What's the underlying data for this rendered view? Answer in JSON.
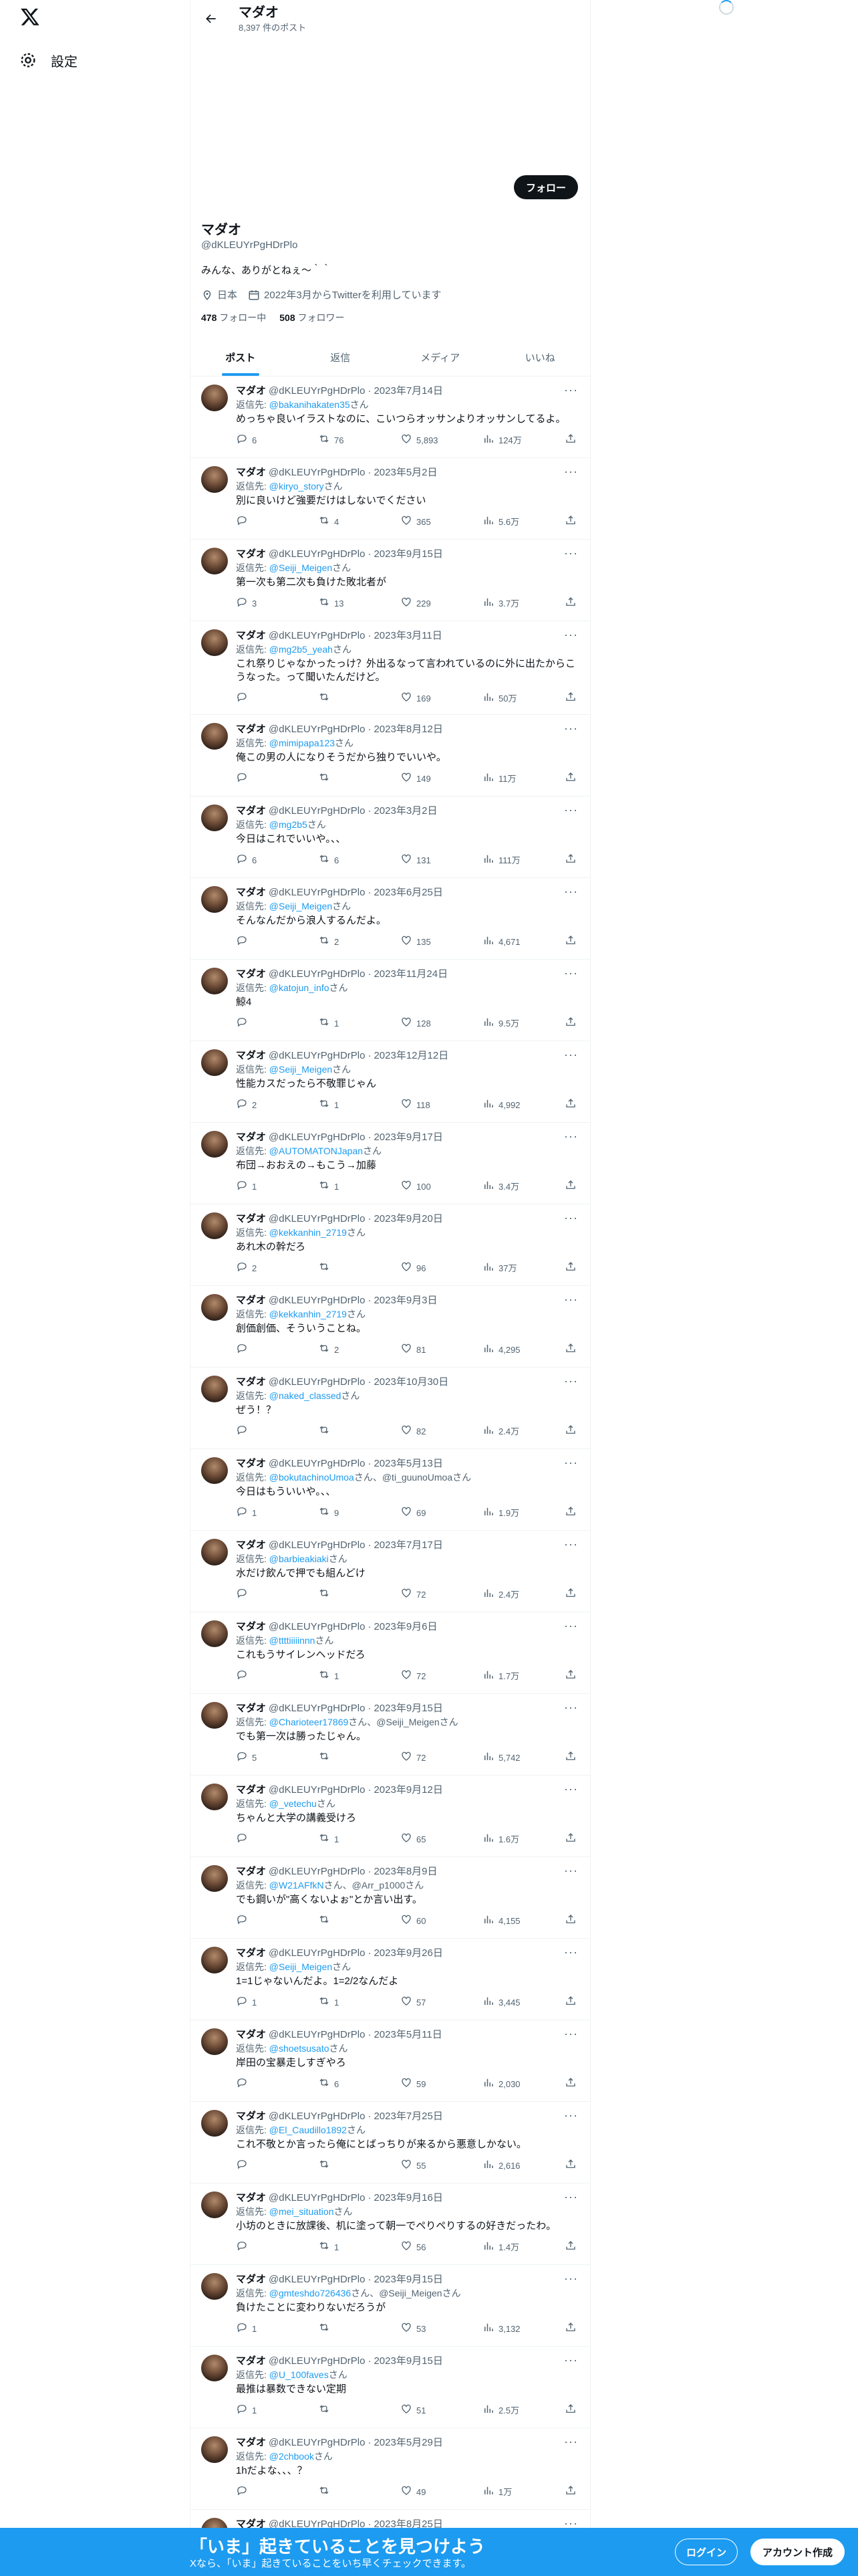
{
  "nav": {
    "settings": "設定"
  },
  "header": {
    "name": "マダオ",
    "posts": "8,397 件のポスト"
  },
  "profile": {
    "follow": "フォロー",
    "name": "マダオ",
    "handle": "@dKLEUYrPgHDrPlo",
    "bio": "みんな、ありがとねぇ～｀｀",
    "location": "日本",
    "joined": "2022年3月からTwitterを利用しています",
    "following_num": "478",
    "following_label": "フォロー中",
    "followers_num": "508",
    "followers_label": "フォロワー"
  },
  "tabs": [
    "ポスト",
    "返信",
    "メディア",
    "いいね"
  ],
  "reply_prefix": "返信先:",
  "tweets": [
    {
      "name": "マダオ",
      "handle": "@dKLEUYrPgHDrPlo",
      "date": "2023年7月14日",
      "reply": "@bakanihakaten35",
      "suffix": "さん",
      "text": "めっちゃ良いイラストなのに、こいつらオッサンよりオッサンしてるよ。",
      "r": "6",
      "rt": "76",
      "l": "5,893",
      "v": "124万"
    },
    {
      "name": "マダオ",
      "handle": "@dKLEUYrPgHDrPlo",
      "date": "2023年5月2日",
      "reply": "@kiryo_story",
      "suffix": "さん",
      "text": "別に良いけど強要だけはしないでください",
      "r": "",
      "rt": "4",
      "l": "365",
      "v": "5.6万"
    },
    {
      "name": "マダオ",
      "handle": "@dKLEUYrPgHDrPlo",
      "date": "2023年9月15日",
      "reply": "@Seiji_Meigen",
      "suffix": "さん",
      "text": "第一次も第二次も負けた敗北者が",
      "r": "3",
      "rt": "13",
      "l": "229",
      "v": "3.7万"
    },
    {
      "name": "マダオ",
      "handle": "@dKLEUYrPgHDrPlo",
      "date": "2023年3月11日",
      "reply": "@mg2b5_yeah",
      "suffix": "さん",
      "text": "これ祭りじゃなかったっけ？外出るなって言われているのに外に出たからこうなった。って聞いたんだけど。",
      "r": "",
      "rt": "",
      "l": "169",
      "v": "50万"
    },
    {
      "name": "マダオ",
      "handle": "@dKLEUYrPgHDrPlo",
      "date": "2023年8月12日",
      "reply": "@mimipapa123",
      "suffix": "さん",
      "text": "俺この男の人になりそうだから独りでいいや。",
      "r": "",
      "rt": "",
      "l": "149",
      "v": "11万"
    },
    {
      "name": "マダオ",
      "handle": "@dKLEUYrPgHDrPlo",
      "date": "2023年3月2日",
      "reply": "@mg2b5",
      "suffix": "さん",
      "text": "今日はこれでいいや。、、",
      "r": "6",
      "rt": "6",
      "l": "131",
      "v": "111万"
    },
    {
      "name": "マダオ",
      "handle": "@dKLEUYrPgHDrPlo",
      "date": "2023年6月25日",
      "reply": "@Seiji_Meigen",
      "suffix": "さん",
      "text": "そんなんだから浪人するんだよ。",
      "r": "",
      "rt": "2",
      "l": "135",
      "v": "4,671"
    },
    {
      "name": "マダオ",
      "handle": "@dKLEUYrPgHDrPlo",
      "date": "2023年11月24日",
      "reply": "@katojun_info",
      "suffix": "さん",
      "text": "鯨4",
      "r": "",
      "rt": "1",
      "l": "128",
      "v": "9.5万"
    },
    {
      "name": "マダオ",
      "handle": "@dKLEUYrPgHDrPlo",
      "date": "2023年12月12日",
      "reply": "@Seiji_Meigen",
      "suffix": "さん",
      "text": "性能カスだったら不敬罪じゃん",
      "r": "2",
      "rt": "1",
      "l": "118",
      "v": "4,992"
    },
    {
      "name": "マダオ",
      "handle": "@dKLEUYrPgHDrPlo",
      "date": "2023年9月17日",
      "reply": "@AUTOMATONJapan",
      "suffix": "さん",
      "text": "布団→おおえの→もこう→加藤",
      "r": "1",
      "rt": "1",
      "l": "100",
      "v": "3.4万"
    },
    {
      "name": "マダオ",
      "handle": "@dKLEUYrPgHDrPlo",
      "date": "2023年9月20日",
      "reply": "@kekkanhin_2719",
      "suffix": "さん",
      "text": "あれ木の幹だろ",
      "r": "2",
      "rt": "",
      "l": "96",
      "v": "37万"
    },
    {
      "name": "マダオ",
      "handle": "@dKLEUYrPgHDrPlo",
      "date": "2023年9月3日",
      "reply": "@kekkanhin_2719",
      "suffix": "さん",
      "text": "創価創価、そういうことね。",
      "r": "",
      "rt": "2",
      "l": "81",
      "v": "4,295"
    },
    {
      "name": "マダオ",
      "handle": "@dKLEUYrPgHDrPlo",
      "date": "2023年10月30日",
      "reply": "@naked_classed",
      "suffix": "さん",
      "text": "ぜう！？",
      "r": "",
      "rt": "",
      "l": "82",
      "v": "2.4万"
    },
    {
      "name": "マダオ",
      "handle": "@dKLEUYrPgHDrPlo",
      "date": "2023年5月13日",
      "reply": "@bokutachinoUmoa",
      "suffix": "さん、@ti_guunoUmoaさん",
      "text": "今日はもういいや。、、",
      "r": "1",
      "rt": "9",
      "l": "69",
      "v": "1.9万"
    },
    {
      "name": "マダオ",
      "handle": "@dKLEUYrPgHDrPlo",
      "date": "2023年7月17日",
      "reply": "@barbieakiaki",
      "suffix": "さん",
      "text": "水だけ飲んで押でも組んどけ",
      "r": "",
      "rt": "",
      "l": "72",
      "v": "2.4万"
    },
    {
      "name": "マダオ",
      "handle": "@dKLEUYrPgHDrPlo",
      "date": "2023年9月6日",
      "reply": "@ttttiiiiinnn",
      "suffix": "さん",
      "text": "これもうサイレンヘッドだろ",
      "r": "",
      "rt": "1",
      "l": "72",
      "v": "1.7万"
    },
    {
      "name": "マダオ",
      "handle": "@dKLEUYrPgHDrPlo",
      "date": "2023年9月15日",
      "reply": "@Charioteer17869",
      "suffix": "さん、@Seiji_Meigenさん",
      "text": "でも第一次は勝ったじゃん。",
      "r": "5",
      "rt": "",
      "l": "72",
      "v": "5,742"
    },
    {
      "name": "マダオ",
      "handle": "@dKLEUYrPgHDrPlo",
      "date": "2023年9月12日",
      "reply": "@_vetechu",
      "suffix": "さん",
      "text": "ちゃんと大学の講義受けろ",
      "r": "",
      "rt": "1",
      "l": "65",
      "v": "1.6万"
    },
    {
      "name": "マダオ",
      "handle": "@dKLEUYrPgHDrPlo",
      "date": "2023年8月9日",
      "reply": "@W21AFfkN",
      "suffix": "さん、@Arr_p1000さん",
      "text": "でも鋼いが\"高くないよぉ\"とか言い出す。",
      "r": "",
      "rt": "",
      "l": "60",
      "v": "4,155"
    },
    {
      "name": "マダオ",
      "handle": "@dKLEUYrPgHDrPlo",
      "date": "2023年9月26日",
      "reply": "@Seiji_Meigen",
      "suffix": "さん",
      "text": "1=1じゃないんだよ。1=2/2なんだよ",
      "r": "1",
      "rt": "1",
      "l": "57",
      "v": "3,445"
    },
    {
      "name": "マダオ",
      "handle": "@dKLEUYrPgHDrPlo",
      "date": "2023年5月11日",
      "reply": "@shoetsusato",
      "suffix": "さん",
      "text": "岸田の宝暴走しすぎやろ",
      "r": "",
      "rt": "6",
      "l": "59",
      "v": "2,030"
    },
    {
      "name": "マダオ",
      "handle": "@dKLEUYrPgHDrPlo",
      "date": "2023年7月25日",
      "reply": "@El_Caudillo1892",
      "suffix": "さん",
      "text": "これ不敬とか言ったら俺にとばっちりが来るから悪意しかない。",
      "r": "",
      "rt": "",
      "l": "55",
      "v": "2,616"
    },
    {
      "name": "マダオ",
      "handle": "@dKLEUYrPgHDrPlo",
      "date": "2023年9月16日",
      "reply": "@mei_situation",
      "suffix": "さん",
      "text": "小坊のときに放課後、机に塗って朝一でペりペりするの好きだったわ。",
      "r": "",
      "rt": "1",
      "l": "56",
      "v": "1.4万"
    },
    {
      "name": "マダオ",
      "handle": "@dKLEUYrPgHDrPlo",
      "date": "2023年9月15日",
      "reply": "@gmteshdo726436",
      "suffix": "さん、@Seiji_Meigenさん",
      "text": "負けたことに変わりないだろうが",
      "r": "1",
      "rt": "",
      "l": "53",
      "v": "3,132"
    },
    {
      "name": "マダオ",
      "handle": "@dKLEUYrPgHDrPlo",
      "date": "2023年9月15日",
      "reply": "@U_100faves",
      "suffix": "さん",
      "text": "最推は暴数できない定期",
      "r": "1",
      "rt": "",
      "l": "51",
      "v": "2.5万"
    },
    {
      "name": "マダオ",
      "handle": "@dKLEUYrPgHDrPlo",
      "date": "2023年5月29日",
      "reply": "@2chbook",
      "suffix": "さん",
      "text": "1hだよな、、、？",
      "r": "",
      "rt": "",
      "l": "49",
      "v": "1万"
    },
    {
      "name": "マダオ",
      "handle": "@dKLEUYrPgHDrPlo",
      "date": "2023年8月25日",
      "reply": "",
      "suffix": "",
      "text": "",
      "r": "",
      "rt": "",
      "l": "",
      "v": ""
    }
  ],
  "bottom": {
    "title": "「いま」起きていることを見つけよう",
    "subtitle": "Xなら、「いま」起きていることをいち早くチェックできます。",
    "login": "ログイン",
    "signup": "アカウント作成"
  }
}
